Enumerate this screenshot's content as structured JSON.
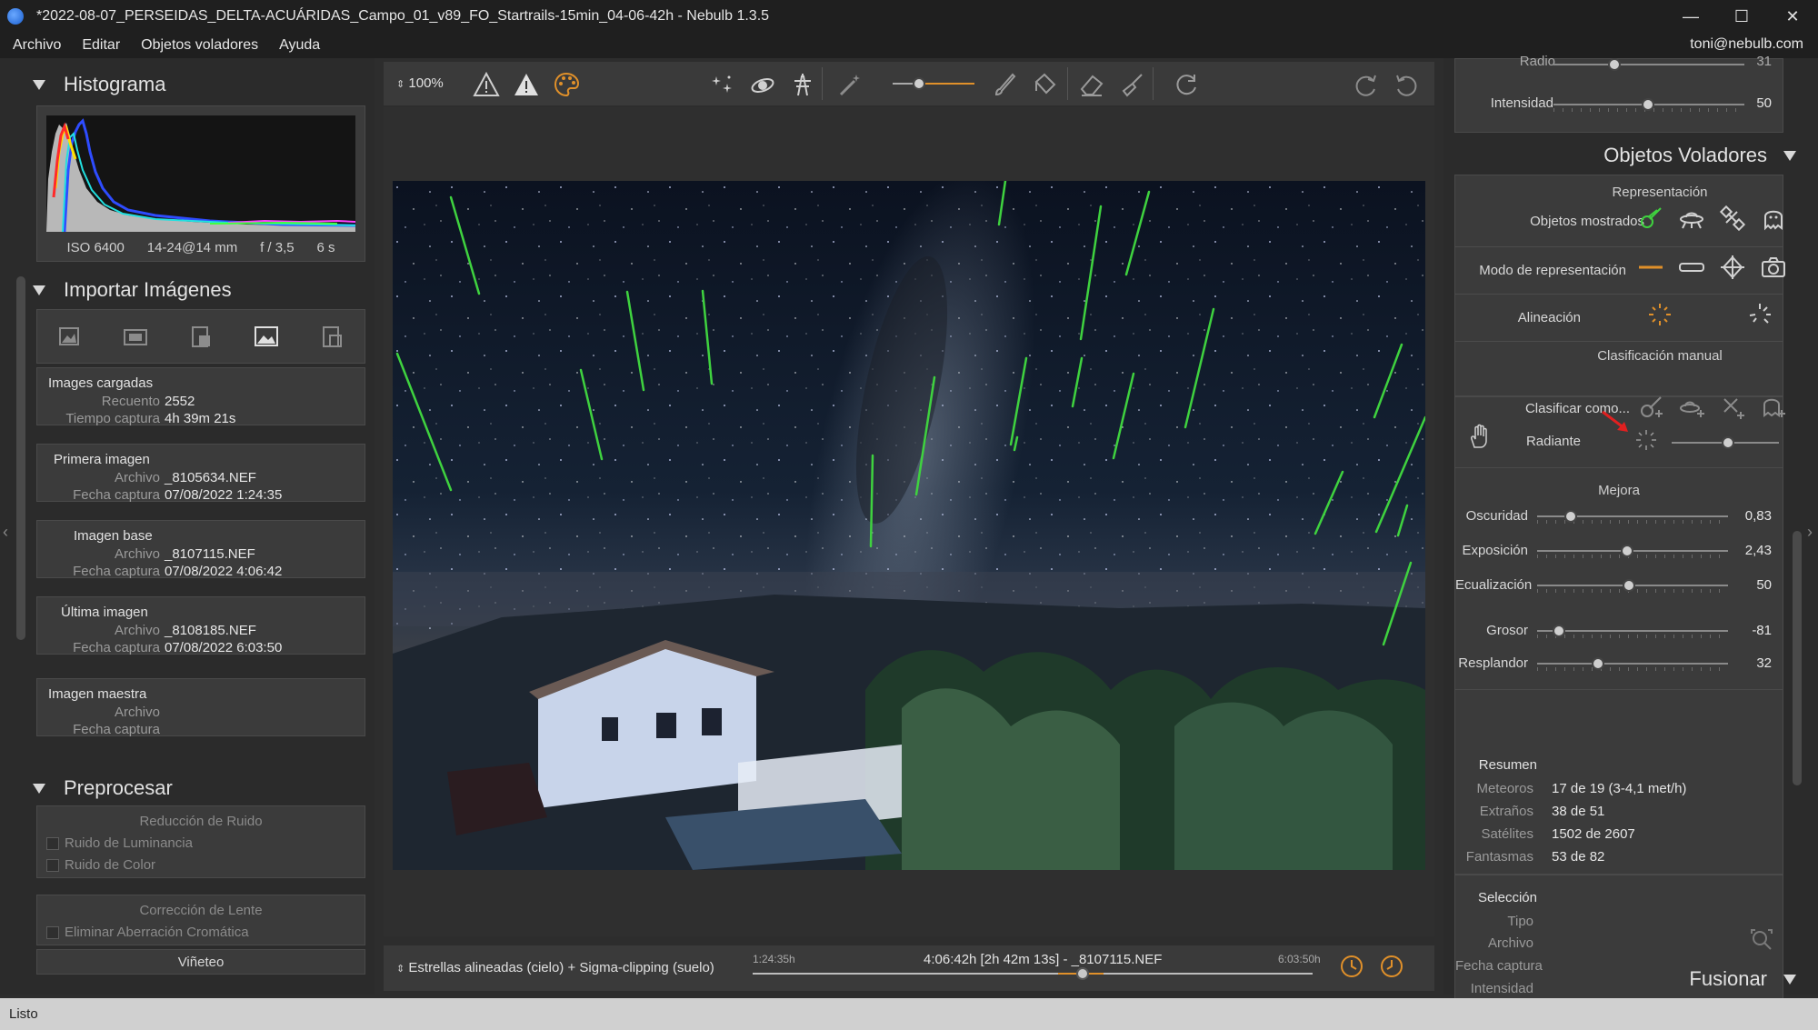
{
  "window": {
    "title": "*2022-08-07_PERSEIDAS_DELTA-ACUÁRIDAS_Campo_01_v89_FO_Startrails-15min_04-06-42h - Nebulb 1.3.5",
    "minimize": "—",
    "maximize": "☐",
    "close": "✕"
  },
  "menu": {
    "items": [
      "Archivo",
      "Editar",
      "Objetos voladores",
      "Ayuda"
    ],
    "user": "toni@nebulb.com"
  },
  "left": {
    "histogram": {
      "title": "Histograma",
      "iso": "ISO 6400",
      "lens": "14-24@14 mm",
      "aperture": "f / 3,5",
      "exposure": "6 s"
    },
    "import": {
      "title": "Importar Imágenes",
      "loaded": {
        "header": "Images cargadas",
        "count_label": "Recuento",
        "count": "2552",
        "time_label": "Tiempo captura",
        "time": "4h 39m 21s"
      },
      "first": {
        "header": "Primera imagen",
        "file_label": "Archivo",
        "file": "_8105634.NEF",
        "date_label": "Fecha captura",
        "date": "07/08/2022 1:24:35"
      },
      "base": {
        "header": "Imagen base",
        "file_label": "Archivo",
        "file": "_8107115.NEF",
        "date_label": "Fecha captura",
        "date": "07/08/2022 4:06:42"
      },
      "last": {
        "header": "Última imagen",
        "file_label": "Archivo",
        "file": "_8108185.NEF",
        "date_label": "Fecha captura",
        "date": "07/08/2022 6:03:50"
      },
      "master": {
        "header": "Imagen maestra",
        "file_label": "Archivo",
        "date_label": "Fecha captura"
      }
    },
    "preprocess": {
      "title": "Preprocesar",
      "noise_header": "Reducción de Ruido",
      "luminance": "Ruido de Luminancia",
      "color": "Ruido de Color",
      "lens_header": "Corrección de Lente",
      "chromatic": "Eliminar Aberración Cromática",
      "vignette": "Viñeteo"
    }
  },
  "toolbar": {
    "zoom": "100%",
    "zoom_arrows": "⌃⌄"
  },
  "timeline": {
    "mode": "Estrellas alineadas (cielo) + Sigma-clipping (suelo)",
    "start": "1:24:35h",
    "current": "4:06:42h [2h 42m 13s] - _8107115.NEF",
    "end": "6:03:50h",
    "position": 0.5
  },
  "right": {
    "top_partial": {
      "radio_label": "Radio",
      "radio_value": "31",
      "intensity_label": "Intensidad",
      "intensity_value": "50"
    },
    "flying": {
      "title": "Objetos Voladores",
      "representation": "Representación",
      "shown_objects": "Objetos mostrados",
      "render_mode": "Modo de representación",
      "alignment": "Alineación",
      "manual": "Clasificación manual",
      "classify_as": "Clasificar como...",
      "radiant": "Radiante",
      "improve": "Mejora",
      "darkness_label": "Oscuridad",
      "darkness_value": "0,83",
      "exposure_label": "Exposición",
      "exposure_value": "2,43",
      "equalization_label": "Ecualización",
      "equalization_value": "50",
      "thickness_label": "Grosor",
      "thickness_value": "-81",
      "glow_label": "Resplandor",
      "glow_value": "32"
    },
    "summary": {
      "header": "Resumen",
      "meteors_label": "Meteoros",
      "meteors": "17 de 19 (3-4,1 met/h)",
      "strange_label": "Extraños",
      "strange": "38 de 51",
      "satellites_label": "Satélites",
      "satellites": "1502 de 2607",
      "ghosts_label": "Fantasmas",
      "ghosts": "53 de 82"
    },
    "selection": {
      "header": "Selección",
      "type_label": "Tipo",
      "file_label": "Archivo",
      "date_label": "Fecha captura",
      "intensity_label": "Intensidad"
    },
    "merge_title": "Fusionar"
  },
  "status": {
    "text": "Listo"
  },
  "colors": {
    "accent_orange": "#e0902a",
    "meteor_green": "#3fd23f",
    "radiant_red": "#e02020"
  }
}
